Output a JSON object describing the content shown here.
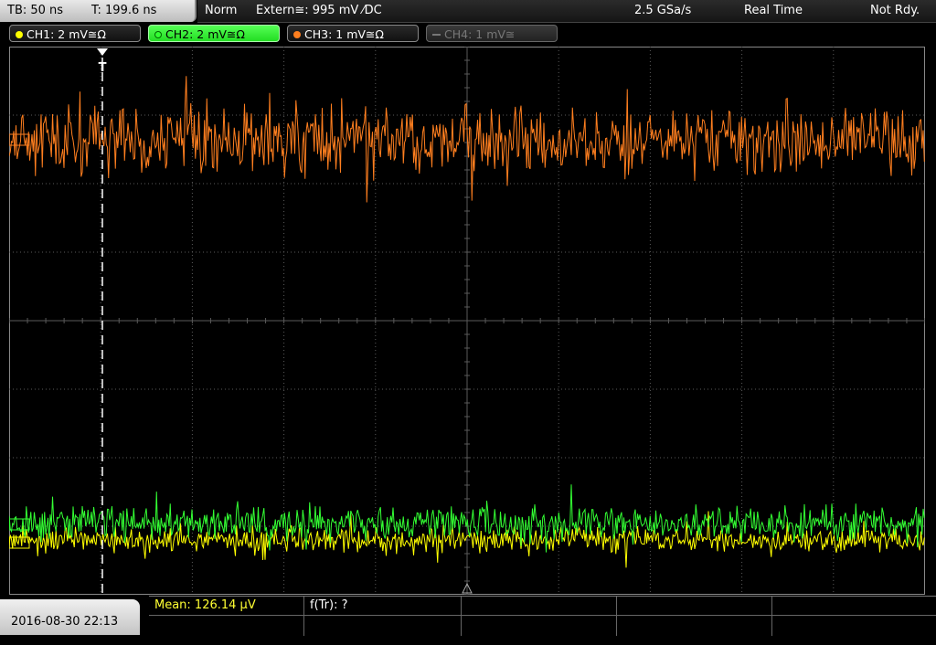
{
  "header": {
    "timebase": "TB: 50 ns",
    "trigger_time": "T: 199.6 ns",
    "acq_mode": "Norm",
    "trigger_source": "Extern≅: 995 mV ⁄DC",
    "sample_rate": "2.5 GSa/s",
    "acq_type": "Real Time",
    "ready_state": "Not Rdy."
  },
  "channels": [
    {
      "label": "CH1: 2 mV≅Ω",
      "color": "#ffff00",
      "state": "on"
    },
    {
      "label": "CH2: 2 mV≅Ω",
      "color": "#33ff33",
      "state": "selected"
    },
    {
      "label": "CH3: 1 mV≅Ω",
      "color": "#ff7f1f",
      "state": "on"
    },
    {
      "label": "CH4: 1 mV≅",
      "color": "#777777",
      "state": "off"
    }
  ],
  "trigger_marker": "T",
  "footer": {
    "datetime": "2016-08-30 22:13",
    "measurement": "Mean: 126.14 µV",
    "function": "f(Tr): ?"
  },
  "colors": {
    "grid": "#5a5a5a",
    "ch1": "#ffff00",
    "ch2": "#33ff33",
    "ch3": "#ff7f1f"
  }
}
